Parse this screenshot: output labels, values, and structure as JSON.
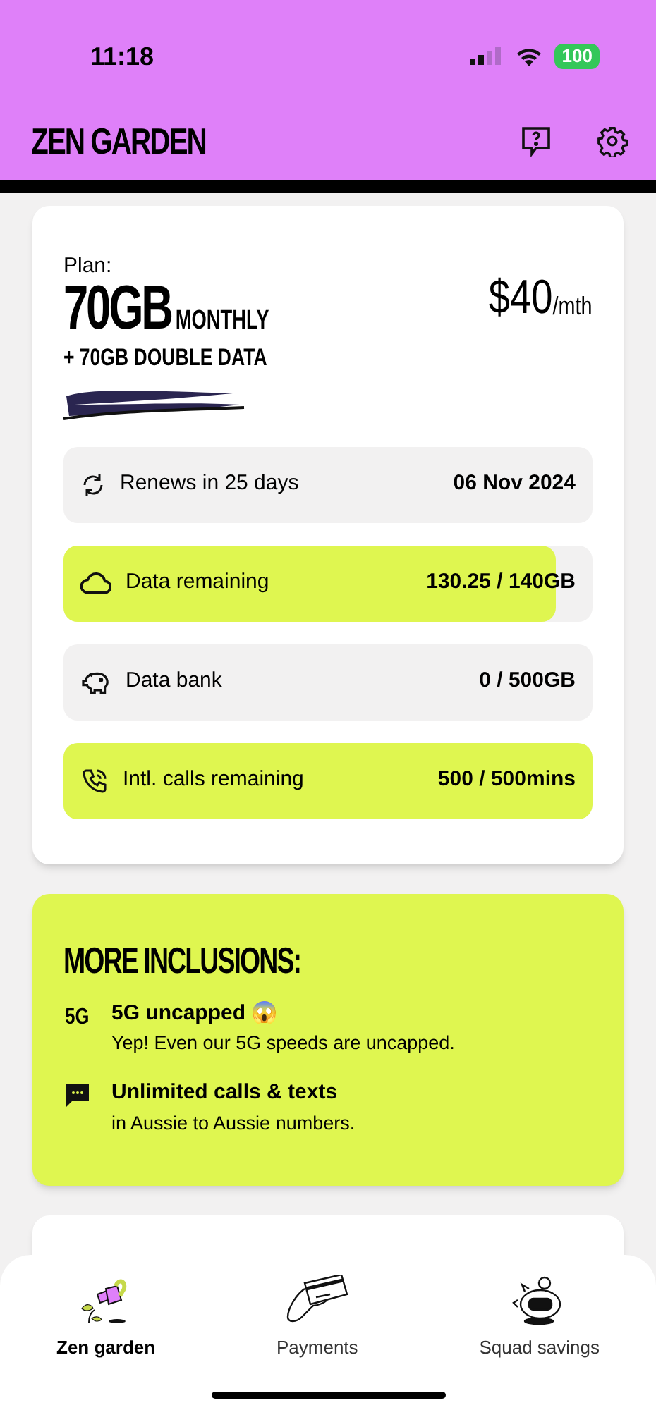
{
  "status_bar": {
    "time": "11:18",
    "battery": "100"
  },
  "header": {
    "title": "ZEN GARDEN"
  },
  "plan": {
    "label": "Plan:",
    "size": "70GB",
    "period": "MONTHLY",
    "bonus": "+ 70GB DOUBLE DATA",
    "price": "$40",
    "price_unit": "/mth"
  },
  "usage_rows": [
    {
      "kind": "renew",
      "label": "Renews in 25 days",
      "value": "06 Nov 2024"
    },
    {
      "kind": "data",
      "label": "Data remaining",
      "value": "130.25 / 140GB",
      "level": 0.93
    },
    {
      "kind": "bank",
      "label": "Data bank",
      "value": "0 / 500GB",
      "level": 0
    },
    {
      "kind": "calls",
      "label": "Intl. calls remaining",
      "value": "500 / 500mins",
      "level": 1
    }
  ],
  "inclusions": {
    "title": "MORE INCLUSIONS:",
    "items": [
      {
        "kind": "fiveg",
        "icon_text": "5G",
        "title": "5G uncapped 😱",
        "subtitle": "Yep! Even our 5G speeds are uncapped."
      },
      {
        "kind": "chat",
        "title": "Unlimited calls & texts",
        "subtitle": "in Aussie to Aussie numbers."
      }
    ]
  },
  "bottom_nav": [
    {
      "kind": "garden",
      "label": "Zen garden",
      "selected": true
    },
    {
      "kind": "payments",
      "label": "Payments",
      "selected": false
    },
    {
      "kind": "savings",
      "label": "Squad savings",
      "selected": false
    }
  ]
}
